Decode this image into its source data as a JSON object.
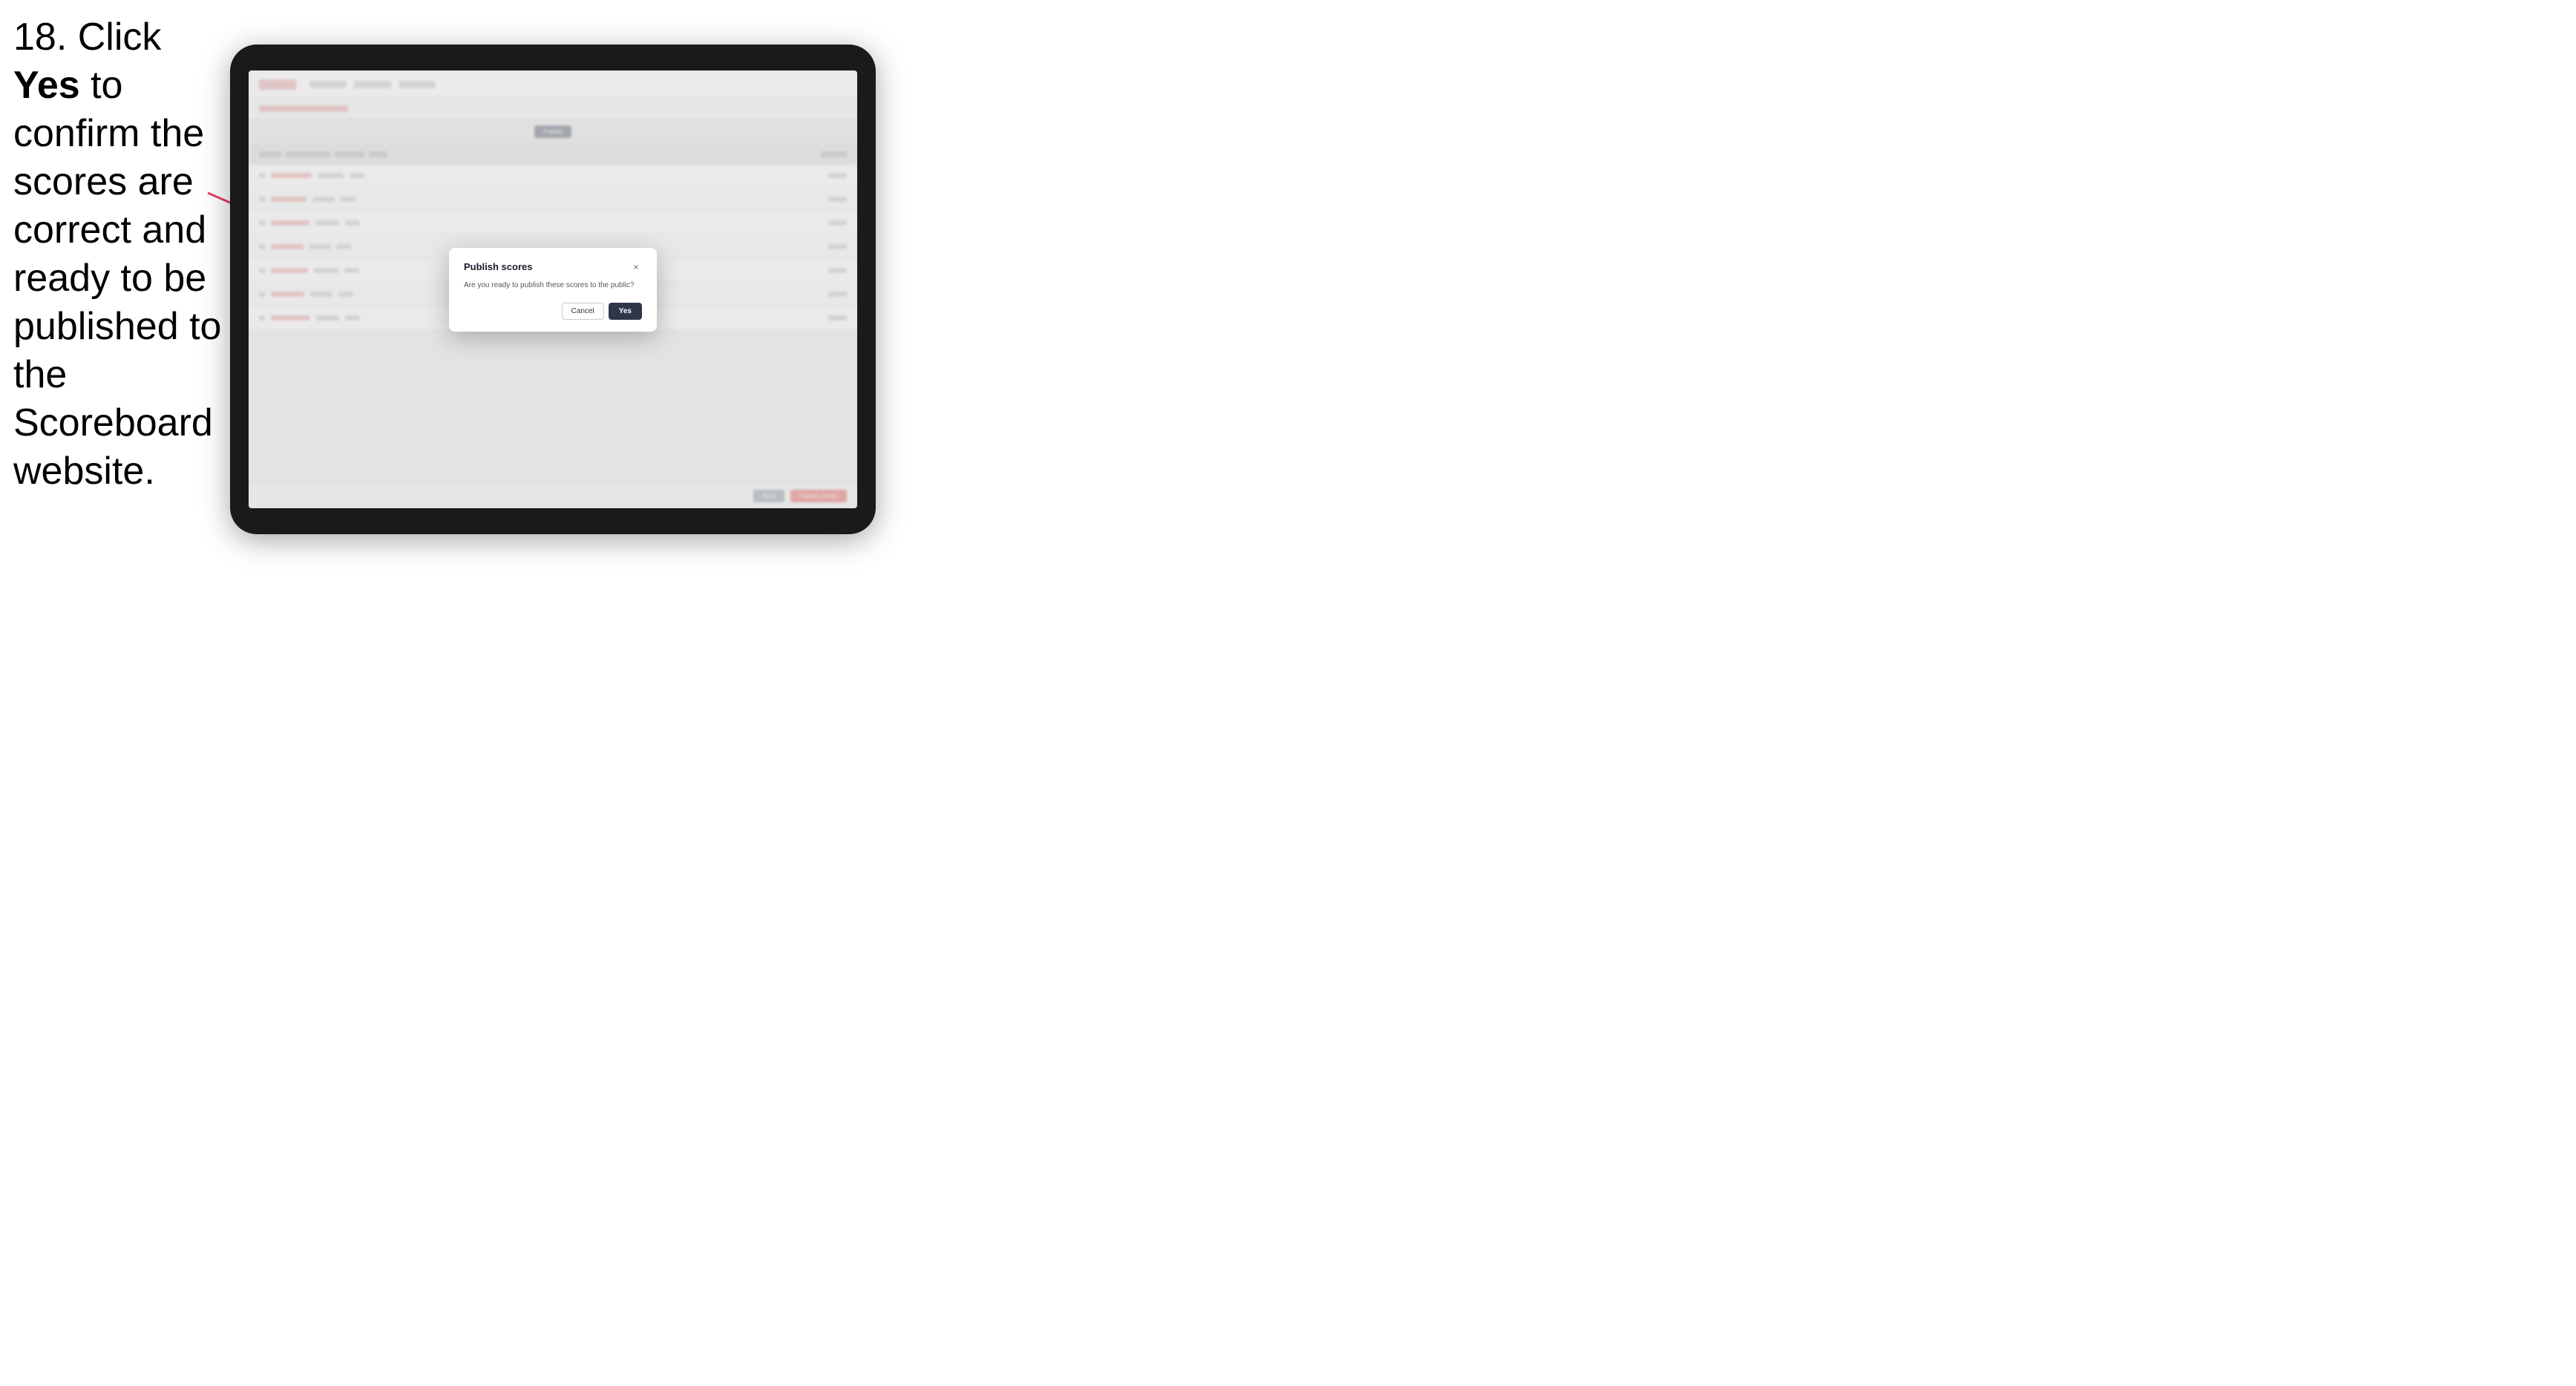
{
  "instruction": {
    "step_number": "18.",
    "text_part1": " Click ",
    "bold_text": "Yes",
    "text_part2": " to confirm the scores are correct and ready to be published to the Scoreboard website."
  },
  "tablet": {
    "screen": {
      "bg_rows": [
        {
          "cells": [
            "40px",
            "60px",
            "30px",
            "20px",
            "50px"
          ]
        },
        {
          "cells": [
            "50px",
            "40px",
            "25px",
            "20px",
            "45px"
          ]
        },
        {
          "cells": [
            "45px",
            "55px",
            "30px",
            "20px",
            "50px"
          ]
        },
        {
          "cells": [
            "35px",
            "50px",
            "25px",
            "20px",
            "40px"
          ]
        },
        {
          "cells": [
            "50px",
            "45px",
            "30px",
            "20px",
            "50px"
          ]
        },
        {
          "cells": [
            "40px",
            "50px",
            "25px",
            "20px",
            "45px"
          ]
        },
        {
          "cells": [
            "55px",
            "40px",
            "30px",
            "20px",
            "50px"
          ]
        }
      ]
    }
  },
  "modal": {
    "title": "Publish scores",
    "body": "Are you ready to publish these scores to the public?",
    "cancel_label": "Cancel",
    "yes_label": "Yes",
    "close_icon": "×"
  }
}
